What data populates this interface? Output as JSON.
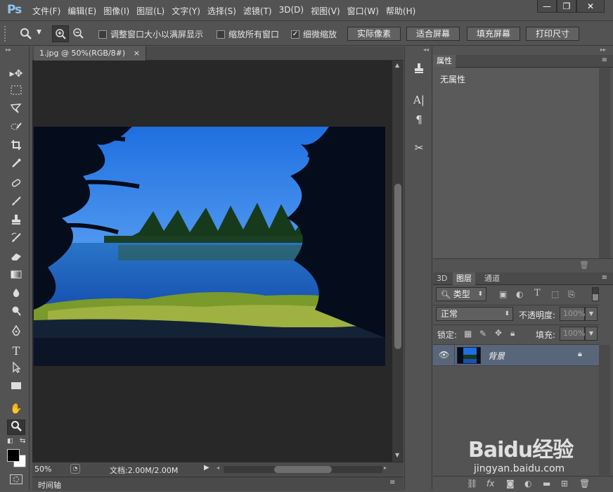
{
  "app": {
    "logo": "Ps"
  },
  "menu": [
    "文件(F)",
    "编辑(E)",
    "图像(I)",
    "图层(L)",
    "文字(Y)",
    "选择(S)",
    "滤镜(T)",
    "3D(D)",
    "视图(V)",
    "窗口(W)",
    "帮助(H)"
  ],
  "window_controls": {
    "minimize": "—",
    "restore": "❐",
    "close": "✕"
  },
  "options": {
    "resize_windows": "调整窗口大小以满屏显示",
    "resize_windows_checked": false,
    "zoom_all": "缩放所有窗口",
    "zoom_all_checked": false,
    "scrubby_zoom": "细微缩放",
    "scrubby_zoom_checked": true,
    "btn_actual_pixels": "实际像素",
    "btn_fit_screen": "适合屏幕",
    "btn_fill_screen": "填充屏幕",
    "btn_print_size": "打印尺寸"
  },
  "document": {
    "tab_title": "1.jpg @ 50%(RGB/8#)",
    "tab_close": "×",
    "zoom": "50%",
    "doc_info": "文档:2.00M/2.00M"
  },
  "timeline": {
    "label": "时间轴"
  },
  "properties": {
    "title": "属性",
    "content": "无属性"
  },
  "layers_panel": {
    "tabs": [
      "3D",
      "图层",
      "通道"
    ],
    "active_tab": "图层",
    "filter_kind": "类型",
    "blend_mode": "正常",
    "opacity_label": "不透明度:",
    "opacity_value": "100%",
    "lock_label": "锁定:",
    "fill_label": "填充:",
    "fill_value": "100%",
    "layers": [
      {
        "name": "背景",
        "visible": true,
        "locked": true
      }
    ]
  },
  "watermark": {
    "brand": "Baidu经验",
    "url": "jingyan.baidu.com"
  },
  "colors": {
    "ui_bg": "#535353",
    "canvas_bg": "#282828",
    "selected_layer": "#59667a",
    "accent": "#8cc3f0"
  }
}
